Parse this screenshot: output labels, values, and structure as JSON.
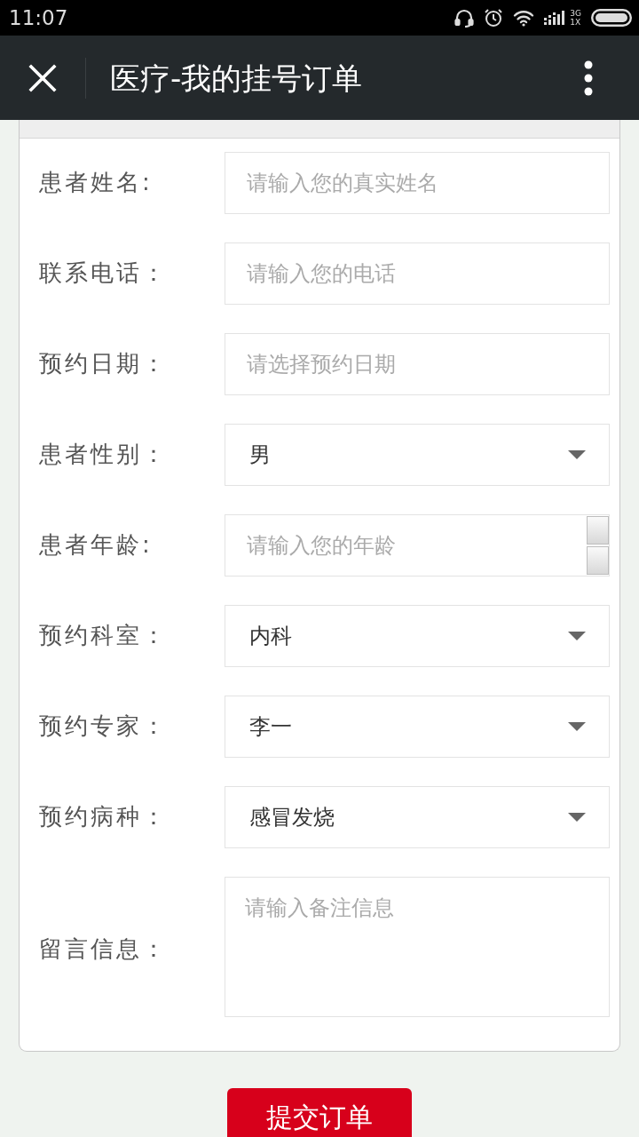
{
  "status_bar": {
    "time": "11:07",
    "network_top": "3G",
    "network_bottom": "1X"
  },
  "header": {
    "title": "医疗-我的挂号订单"
  },
  "form": {
    "fields": [
      {
        "kind": "text",
        "label": "患者姓名:",
        "placeholder": "请输入您的真实姓名"
      },
      {
        "kind": "text",
        "label": "联系电话：",
        "placeholder": "请输入您的电话"
      },
      {
        "kind": "text",
        "label": "预约日期：",
        "placeholder": "请选择预约日期"
      },
      {
        "kind": "select",
        "label": "患者性别：",
        "value": "男"
      },
      {
        "kind": "number",
        "label": "患者年龄:",
        "placeholder": "请输入您的年龄"
      },
      {
        "kind": "select",
        "label": "预约科室：",
        "value": "内科"
      },
      {
        "kind": "select",
        "label": "预约专家：",
        "value": "李一"
      },
      {
        "kind": "select",
        "label": "预约病种：",
        "value": "感冒发烧"
      },
      {
        "kind": "textarea",
        "label": "留言信息：",
        "placeholder": "请输入备注信息"
      }
    ]
  },
  "submit_button": {
    "label": "提交订单"
  }
}
